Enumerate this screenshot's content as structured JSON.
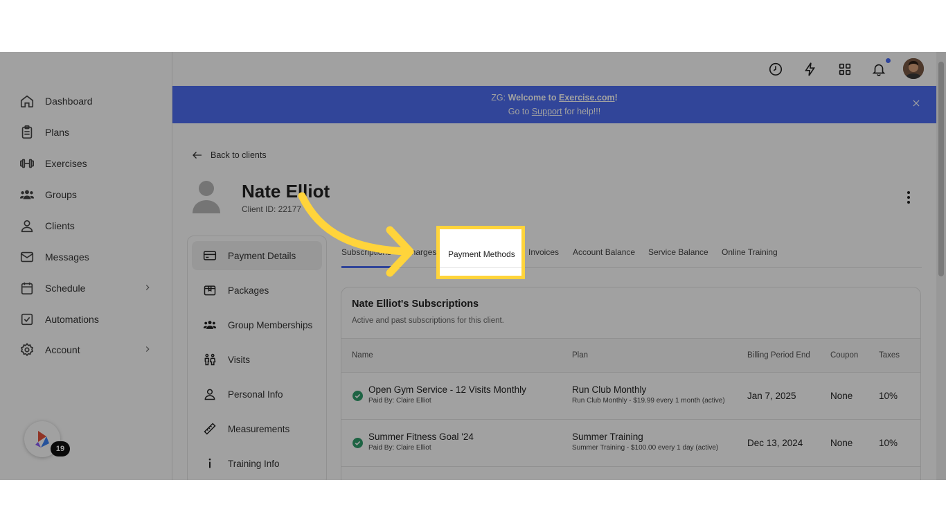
{
  "sidebar": {
    "items": [
      {
        "label": "Dashboard",
        "icon": "home-icon"
      },
      {
        "label": "Plans",
        "icon": "clipboard-icon"
      },
      {
        "label": "Exercises",
        "icon": "dumbbell-icon"
      },
      {
        "label": "Groups",
        "icon": "users-icon"
      },
      {
        "label": "Clients",
        "icon": "user-icon"
      },
      {
        "label": "Messages",
        "icon": "mail-icon"
      },
      {
        "label": "Schedule",
        "icon": "calendar-icon"
      },
      {
        "label": "Automations",
        "icon": "checkbox-icon"
      },
      {
        "label": "Account",
        "icon": "gear-icon"
      }
    ],
    "widget_badge": "19"
  },
  "banner": {
    "prefix": "ZG: ",
    "welcome": "Welcome to ",
    "site_link": "Exercise.com",
    "exclaim": "!",
    "goto": "Go to ",
    "support_link": "Support",
    "help": " for help!!!"
  },
  "client": {
    "back_label": "Back to clients",
    "name": "Nate Elliot",
    "client_id": "Client ID: 22177"
  },
  "subnav": {
    "items": [
      {
        "label": "Payment Details",
        "icon": "credit-card-icon"
      },
      {
        "label": "Packages",
        "icon": "package-icon"
      },
      {
        "label": "Group Memberships",
        "icon": "group-icon"
      },
      {
        "label": "Visits",
        "icon": "people-icon"
      },
      {
        "label": "Personal Info",
        "icon": "person-icon"
      },
      {
        "label": "Measurements",
        "icon": "ruler-icon"
      },
      {
        "label": "Training Info",
        "icon": "info-icon"
      }
    ]
  },
  "tabs": {
    "subscriptions": "Subscriptions",
    "charges": "Charges",
    "payment_methods": "Payment Methods",
    "invoices": "Invoices",
    "account_balance": "Account Balance",
    "service_balance": "Service Balance",
    "online_training": "Online Training"
  },
  "subscriptions": {
    "title": "Nate Elliot's Subscriptions",
    "subtitle": "Active and past subscriptions for this client.",
    "columns": {
      "name": "Name",
      "plan": "Plan",
      "billing": "Billing Period End",
      "coupon": "Coupon",
      "taxes": "Taxes"
    },
    "rows": [
      {
        "name": "Open Gym Service - 12 Visits Monthly",
        "paid_by": "Paid By: Claire Elliot",
        "plan": "Run Club Monthly",
        "plan_detail": "Run Club Monthly - $19.99 every 1 month (active)",
        "billing": "Jan 7, 2025",
        "coupon": "None",
        "taxes": "10%"
      },
      {
        "name": "Summer Fitness Goal '24",
        "paid_by": "Paid By: Claire Elliot",
        "plan": "Summer Training",
        "plan_detail": "Summer Training - $100.00 every 1 day (active)",
        "billing": "Dec 13, 2024",
        "coupon": "None",
        "taxes": "10%"
      }
    ]
  },
  "colors": {
    "accent": "#4e6ef2",
    "highlight": "#ffd43b",
    "success": "#2e9e6b"
  }
}
